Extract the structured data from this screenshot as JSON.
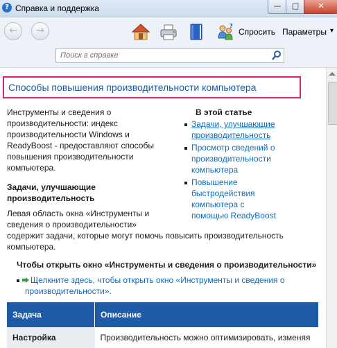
{
  "window": {
    "title": "Справка и поддержка",
    "buttons": {
      "minimize": "—",
      "maximize": "□",
      "close": "✕"
    }
  },
  "toolbar": {
    "back_icon": "back-arrow-icon",
    "forward_icon": "forward-arrow-icon",
    "home_icon": "home-icon",
    "print_icon": "printer-icon",
    "browse_icon": "book-icon",
    "ask_icon": "people-question-icon",
    "ask_label": "Спросить",
    "options_label": "Параметры",
    "options_arrow": "▾"
  },
  "search": {
    "placeholder": "Поиск в справке"
  },
  "article": {
    "heading": "Способы повышения производительности компьютера",
    "intro_lines": [
      "Инструменты и сведения о",
      "производительности: индекс",
      "производительности Windows и",
      "ReadyBoost - предоставляют способы",
      "повышения производительности",
      "компьютера."
    ],
    "toc_title": "В этой статье",
    "toc": [
      {
        "lines": [
          "Задачи, улучшающие",
          "производительность"
        ]
      },
      {
        "lines": [
          "Просмотр сведений о",
          "производительности",
          "компьютера"
        ]
      },
      {
        "lines": [
          "Повышение",
          "быстродействия",
          "компьютера с",
          "помощью ReadyBoost"
        ]
      }
    ],
    "section_title_lines": [
      "Задачи, улучшающие",
      "производительность"
    ],
    "section_lines": [
      "Левая область окна «Инструменты и",
      "сведения о производительности»",
      "содержит задачи, которые могут помочь повысить производительность",
      "компьютера."
    ],
    "open_title": "Чтобы открыть окно «Инструменты и сведения о производительности»",
    "open_link_lines": [
      "Щелкните здесь, чтобы открыть окно «Инструменты и сведения о",
      "производительности»."
    ],
    "table": {
      "headers": [
        "Задача",
        "Описание"
      ],
      "rows": [
        [
          "Настройка",
          "Производительность можно оптимизировать, изменяя"
        ]
      ]
    }
  },
  "colors": {
    "heading_border": "#e0206e",
    "heading_text": "#1a5aa8",
    "link": "#0f6bbf",
    "table_header": "#1e5aa6",
    "toolbar_bg": "#edf2f9"
  }
}
